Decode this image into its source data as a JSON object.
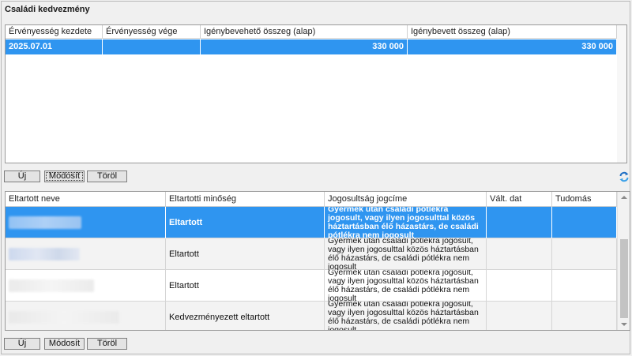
{
  "panel": {
    "title": "Családi kedvezmény"
  },
  "top_grid": {
    "columns": [
      "Érvényesség kezdete",
      "Érvényesség vége",
      "Igénybevehető összeg (alap)",
      "Igénybevett összeg (alap)"
    ],
    "rows": [
      {
        "start": "2025.07.01",
        "end": "",
        "available": "330 000",
        "used": "330 000"
      }
    ]
  },
  "top_buttons": {
    "new": "Új",
    "modify": "Módosít",
    "delete": "Töröl"
  },
  "bottom_grid": {
    "columns": [
      "Eltartott neve",
      "Eltartotti minőség",
      "Jogosultság jogcíme",
      "Vált. dat",
      "Tudomás"
    ],
    "rows": [
      {
        "name": "",
        "quality": "Eltartott",
        "entitlement": "Gyermek után családi pótlékra jogosult, vagy ilyen jogosulttal közös háztartásban élő házastárs, de családi pótlékra nem jogosult",
        "change_date": "",
        "knowledge": ""
      },
      {
        "name": "",
        "quality": "Eltartott",
        "entitlement": "Gyermek után családi pótlékra jogosult, vagy ilyen jogosulttal közös háztartásban élő házastárs, de családi pótlékra nem jogosult",
        "change_date": "",
        "knowledge": ""
      },
      {
        "name": "",
        "quality": "Eltartott",
        "entitlement": "Gyermek után családi pótlékra jogosult, vagy ilyen jogosulttal közös háztartásban élő házastárs, de családi pótlékra nem jogosult",
        "change_date": "",
        "knowledge": ""
      },
      {
        "name": "",
        "quality": "Kedvezményezett eltartott",
        "entitlement": "Gyermek után családi pótlékra jogosult, vagy ilyen jogosulttal közös háztartásban élő házastárs, de családi pótlékra nem jogosult",
        "change_date": "",
        "knowledge": ""
      }
    ]
  },
  "bottom_buttons": {
    "new": "Új",
    "modify": "Módosít",
    "delete": "Töröl"
  },
  "icons": {
    "refresh": "refresh-icon"
  },
  "colors": {
    "selection": "#2f95f0",
    "selection_text": "#ffffff"
  }
}
